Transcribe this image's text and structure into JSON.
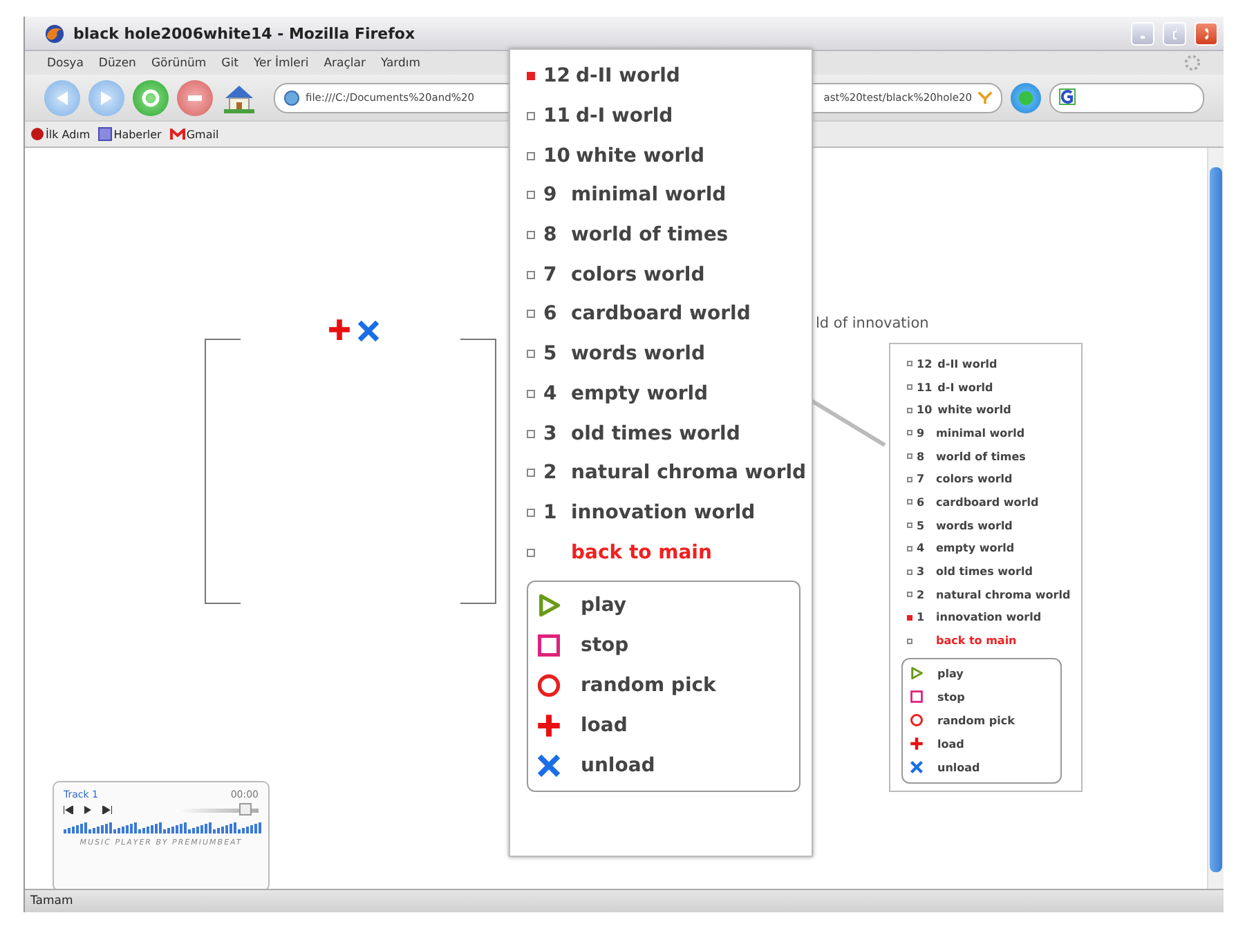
{
  "window": {
    "title": "black hole2006white14 - Mozilla Firefox"
  },
  "menu": [
    "Dosya",
    "Düzen",
    "Görünüm",
    "Git",
    "Yer İmleri",
    "Araçlar",
    "Yardım"
  ],
  "address": {
    "value_start": "file:///C:/Documents%20and%20",
    "value_end": "ast%20test/black%20hole20"
  },
  "bookmarks": [
    "İlk Adım",
    "Haberler",
    "Gmail"
  ],
  "page": {
    "heading": "ld of innovation",
    "menu": {
      "worlds": [
        {
          "number": "12",
          "name": "d-II world",
          "selected": false
        },
        {
          "number": "11",
          "name": "d-I world",
          "selected": false
        },
        {
          "number": "10",
          "name": "white world",
          "selected": false
        },
        {
          "number": "9",
          "name": "minimal world",
          "selected": false
        },
        {
          "number": "8",
          "name": "world of times",
          "selected": false
        },
        {
          "number": "7",
          "name": "colors world",
          "selected": false
        },
        {
          "number": "6",
          "name": "cardboard world",
          "selected": false
        },
        {
          "number": "5",
          "name": "words world",
          "selected": false
        },
        {
          "number": "4",
          "name": "empty world",
          "selected": false
        },
        {
          "number": "3",
          "name": "old times world",
          "selected": false
        },
        {
          "number": "2",
          "name": "natural chroma world",
          "selected": false
        },
        {
          "number": "1",
          "name": "innovation world",
          "selected": true
        }
      ],
      "back": "back to main",
      "controls": [
        {
          "kind": "play",
          "label": "play"
        },
        {
          "kind": "stop",
          "label": "stop"
        },
        {
          "kind": "random",
          "label": "random pick"
        },
        {
          "kind": "load",
          "label": "load"
        },
        {
          "kind": "unload",
          "label": "unload"
        }
      ]
    },
    "player": {
      "track": "Track 1",
      "time": "00:00",
      "volume": {
        "level": 0.85
      },
      "credit": "MUSIC PLAYER BY PREMIUMBEAT"
    }
  },
  "callout": {
    "worlds": [
      {
        "number": "12",
        "name": "d-II world",
        "selected": true
      },
      {
        "number": "11",
        "name": "d-I world",
        "selected": false
      },
      {
        "number": "10",
        "name": "white world",
        "selected": false
      },
      {
        "number": "9",
        "name": "minimal world",
        "selected": false
      },
      {
        "number": "8",
        "name": "world of times",
        "selected": false
      },
      {
        "number": "7",
        "name": "colors world",
        "selected": false
      },
      {
        "number": "6",
        "name": "cardboard world",
        "selected": false
      },
      {
        "number": "5",
        "name": "words world",
        "selected": false
      },
      {
        "number": "4",
        "name": "empty world",
        "selected": false
      },
      {
        "number": "3",
        "name": "old times world",
        "selected": false
      },
      {
        "number": "2",
        "name": "natural chroma world",
        "selected": false
      },
      {
        "number": "1",
        "name": "innovation world",
        "selected": false
      }
    ],
    "back": "back to main",
    "controls": [
      {
        "kind": "play",
        "label": "play"
      },
      {
        "kind": "stop",
        "label": "stop"
      },
      {
        "kind": "random",
        "label": "random pick"
      },
      {
        "kind": "load",
        "label": "load"
      },
      {
        "kind": "unload",
        "label": "unload"
      }
    ]
  },
  "status_bar": "Tamam"
}
